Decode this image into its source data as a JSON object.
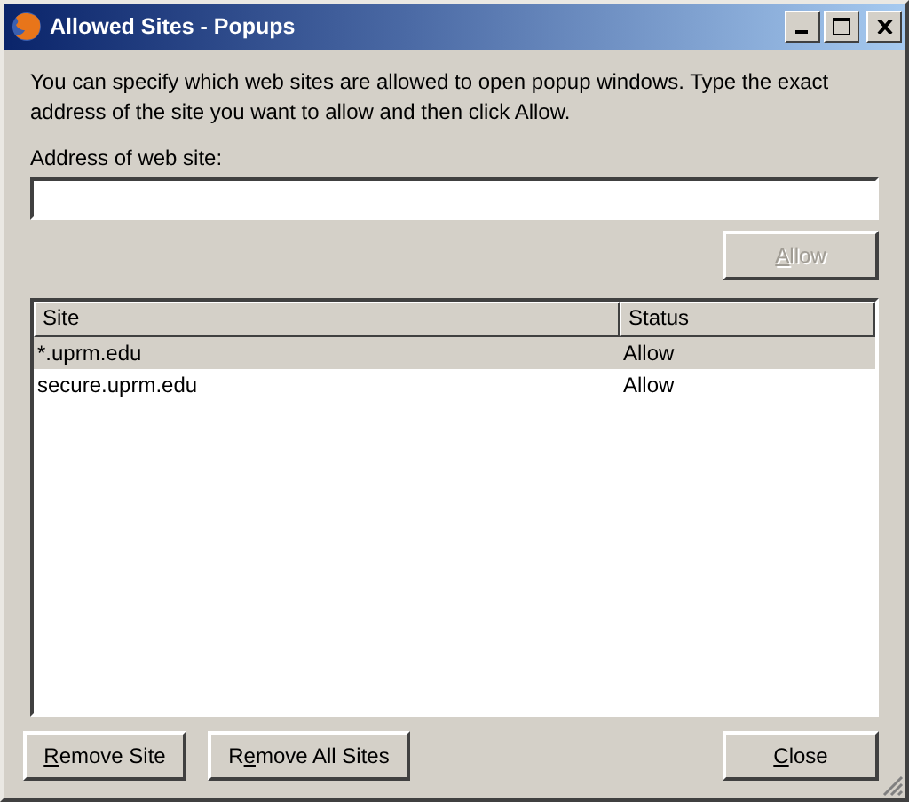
{
  "window": {
    "title": "Allowed Sites - Popups"
  },
  "description": "You can specify which web sites are allowed to open popup windows. Type the exact address of the site you want to allow and then click Allow.",
  "address_field": {
    "label": "Address of web site:"
  },
  "allow_button": {
    "key": "A",
    "post": "llow",
    "disabled": true
  },
  "table": {
    "columns": [
      "Site",
      "Status"
    ],
    "rows": [
      {
        "site": "*.uprm.edu",
        "status": "Allow",
        "selected": true
      },
      {
        "site": "secure.uprm.edu",
        "status": "Allow",
        "selected": false
      }
    ]
  },
  "buttons": [
    {
      "key": "R",
      "post": "emove Site",
      "disabled": false
    },
    {
      "pre": "R",
      "key": "e",
      "post": "move All Sites",
      "disabled": false
    }
  ],
  "close_button": {
    "key": "C",
    "post": "lose",
    "disabled": false
  }
}
